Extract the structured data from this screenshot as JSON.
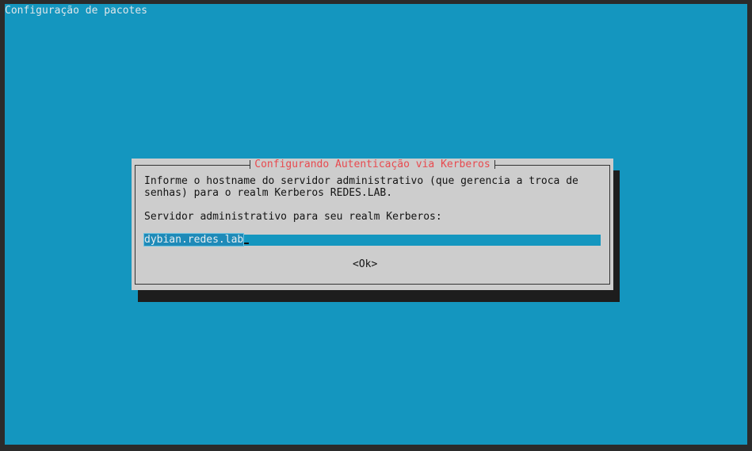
{
  "backtitle": "Configuração de pacotes",
  "dialog": {
    "title": "Configurando Autenticação via Kerberos",
    "description_line1": "Informe o hostname do servidor administrativo (que gerencia a troca de",
    "description_line2": "senhas) para o realm Kerberos REDES.LAB.",
    "prompt": "Servidor administrativo para seu realm Kerberos:",
    "input_value": "dybian.redes.lab",
    "ok_label": "<Ok>"
  },
  "colors": {
    "background": "#1496bf",
    "dialog_bg": "#cdcdcd",
    "title_color": "#e84a4f",
    "shadow": "#1d1d1d"
  }
}
